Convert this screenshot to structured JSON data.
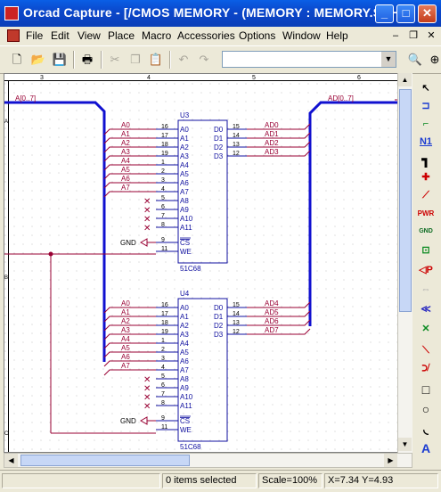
{
  "window": {
    "title": "Orcad Capture - [/CMOS MEMORY - (MEMORY : MEMORY.SCH)]"
  },
  "menu": {
    "items": [
      "File",
      "Edit",
      "View",
      "Place",
      "Macro",
      "Accessories",
      "Options",
      "Window",
      "Help"
    ]
  },
  "toolbar": {
    "combo_value": ""
  },
  "ruler": {
    "labels": [
      "3",
      "4",
      "5",
      "6"
    ],
    "left_labels": [
      "A",
      "B",
      "C"
    ]
  },
  "schematic": {
    "bus_in_label": "A[0..7]",
    "bus_out_label": "AD[0..7]",
    "parts": [
      {
        "ref": "U3",
        "part": "51C68",
        "input_pins": [
          {
            "name": "A0",
            "num": "16",
            "net": "A0"
          },
          {
            "name": "A1",
            "num": "17",
            "net": "A1"
          },
          {
            "name": "A2",
            "num": "18",
            "net": "A2"
          },
          {
            "name": "A3",
            "num": "19",
            "net": "A3"
          },
          {
            "name": "A4",
            "num": "1",
            "net": "A4"
          },
          {
            "name": "A5",
            "num": "2",
            "net": "A5"
          },
          {
            "name": "A6",
            "num": "3",
            "net": "A6"
          },
          {
            "name": "A7",
            "num": "4",
            "net": "A7"
          },
          {
            "name": "A8",
            "num": "5",
            "net": ""
          },
          {
            "name": "A9",
            "num": "6",
            "net": ""
          },
          {
            "name": "A10",
            "num": "7",
            "net": ""
          },
          {
            "name": "A11",
            "num": "8",
            "net": ""
          }
        ],
        "output_pins": [
          {
            "name": "D0",
            "num": "15",
            "net": "AD0"
          },
          {
            "name": "D1",
            "num": "14",
            "net": "AD1"
          },
          {
            "name": "D2",
            "num": "13",
            "net": "AD2"
          },
          {
            "name": "D3",
            "num": "12",
            "net": "AD3"
          }
        ],
        "cs_pin": {
          "name": "CS",
          "num": "9"
        },
        "we_pin": {
          "name": "WE",
          "num": "11"
        },
        "gnd_label": "GND"
      },
      {
        "ref": "U4",
        "part": "51C68",
        "input_pins": [
          {
            "name": "A0",
            "num": "16",
            "net": "A0"
          },
          {
            "name": "A1",
            "num": "17",
            "net": "A1"
          },
          {
            "name": "A2",
            "num": "18",
            "net": "A2"
          },
          {
            "name": "A3",
            "num": "19",
            "net": "A3"
          },
          {
            "name": "A4",
            "num": "1",
            "net": "A4"
          },
          {
            "name": "A5",
            "num": "2",
            "net": "A5"
          },
          {
            "name": "A6",
            "num": "3",
            "net": "A6"
          },
          {
            "name": "A7",
            "num": "4",
            "net": "A7"
          },
          {
            "name": "A8",
            "num": "5",
            "net": ""
          },
          {
            "name": "A9",
            "num": "6",
            "net": ""
          },
          {
            "name": "A10",
            "num": "7",
            "net": ""
          },
          {
            "name": "A11",
            "num": "8",
            "net": ""
          }
        ],
        "output_pins": [
          {
            "name": "D0",
            "num": "15",
            "net": "AD4"
          },
          {
            "name": "D1",
            "num": "14",
            "net": "AD5"
          },
          {
            "name": "D2",
            "num": "13",
            "net": "AD6"
          },
          {
            "name": "D3",
            "num": "12",
            "net": "AD7"
          }
        ],
        "cs_pin": {
          "name": "CS",
          "num": "9"
        },
        "we_pin": {
          "name": "WE",
          "num": "11"
        },
        "gnd_label": "GND"
      }
    ]
  },
  "palette": {
    "tools": [
      "select-arrow",
      "part",
      "wire",
      "net-alias",
      "bus",
      "junction",
      "bus-entry",
      "power",
      "ground",
      "hierarchical-block",
      "hierarchical-port",
      "hierarchical-pin",
      "off-page-connector",
      "no-connect",
      "line",
      "polyline",
      "rectangle",
      "ellipse",
      "arc",
      "text"
    ],
    "labels": {
      "net": "N1",
      "power": "PWR",
      "ground": "GND"
    }
  },
  "status": {
    "left": "",
    "selection": "0 items selected",
    "scale": "Scale=100%",
    "coords": "X=7.34  Y=4.93"
  },
  "colors": {
    "bus": "#1010d0",
    "wire": "#990033",
    "part": "#1010a0",
    "title_bar": "#0b46c9"
  }
}
